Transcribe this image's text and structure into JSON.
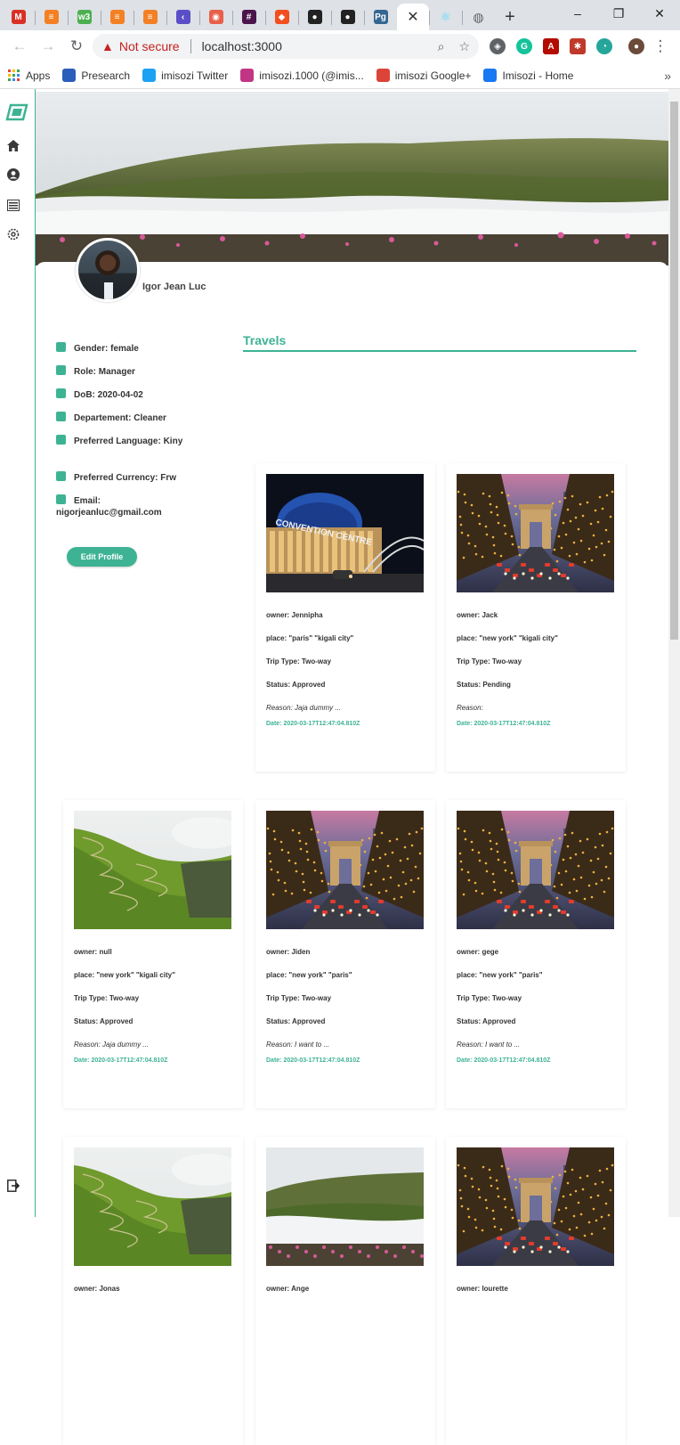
{
  "browser": {
    "tabs": [
      {
        "icon": "gmail-icon",
        "glyph": "M",
        "color": "#d93025"
      },
      {
        "icon": "stackoverflow-icon",
        "glyph": "≡",
        "color": "#f48024"
      },
      {
        "icon": "w3schools-icon",
        "glyph": "w3",
        "color": "#4caf50"
      },
      {
        "icon": "stackoverflow-icon",
        "glyph": "≡",
        "color": "#f48024"
      },
      {
        "icon": "stackoverflow-icon",
        "glyph": "≡",
        "color": "#f48024"
      },
      {
        "icon": "back-icon",
        "glyph": "‹",
        "color": "#5b4fc7"
      },
      {
        "icon": "babel-icon",
        "glyph": "◉",
        "color": "#e8604c"
      },
      {
        "icon": "slack-icon",
        "glyph": "#",
        "color": "#4a154b"
      },
      {
        "icon": "figma-icon",
        "glyph": "◆",
        "color": "#f24e1e"
      },
      {
        "icon": "github-icon",
        "glyph": "●",
        "color": "#222222"
      },
      {
        "icon": "github-icon",
        "glyph": "●",
        "color": "#222222"
      },
      {
        "icon": "postgres-icon",
        "glyph": "Pg",
        "color": "#336791"
      }
    ],
    "active_tab_icon": "close-icon",
    "active_tab_close": "✕",
    "globe_tab_icon": "globe-icon",
    "new_tab": "+",
    "window_controls": [
      "–",
      "❐",
      "✕"
    ],
    "security_label": "Not secure",
    "url": "localhost:3000",
    "bookmarks": [
      {
        "label": "Apps",
        "icon": "apps-icon",
        "color": "#ea4335"
      },
      {
        "label": "Presearch",
        "icon": "presearch-icon",
        "color": "#2b5dba"
      },
      {
        "label": "imisozi Twitter",
        "icon": "twitter-icon",
        "color": "#1da1f2"
      },
      {
        "label": "imisozi.1000 (@imis...",
        "icon": "instagram-icon",
        "color": "#c13584"
      },
      {
        "label": "imisozi Google+",
        "icon": "google-plus-icon",
        "color": "#db4437"
      },
      {
        "label": "Imisozi - Home",
        "icon": "facebook-icon",
        "color": "#1877f2"
      }
    ],
    "bookmarks_more": "»"
  },
  "profile": {
    "name": "Igor Jean Luc",
    "details": [
      {
        "icon": "gender-icon",
        "text": "Gender: female"
      },
      {
        "icon": "role-icon",
        "text": "Role: Manager"
      },
      {
        "icon": "calendar-icon",
        "text": "DoB: 2020-04-02"
      },
      {
        "icon": "department-icon",
        "text": "Departement: Cleaner"
      },
      {
        "icon": "language-icon",
        "text": "Preferred Language: Kiny"
      },
      {
        "icon": "currency-icon",
        "text": "Preferred Currency: Frw"
      },
      {
        "icon": "email-icon",
        "text": "Email: nigorjeanluc@gmail.com"
      }
    ],
    "edit_button": "Edit Profile"
  },
  "travels": {
    "title": "Travels",
    "cards": [
      {
        "photo": "convention",
        "owner": "owner: Jennipha",
        "place": "place: \"paris\" \"kigali city\"",
        "trip_type": "Trip Type: Two-way",
        "status": "Status: Approved",
        "reason": "Reason: Jaja dummy ...",
        "date": "Date: 2020-03-17T12:47:04.810Z"
      },
      {
        "photo": "arc",
        "owner": "owner: Jack",
        "place": "place: \"new york\" \"kigali city\"",
        "trip_type": "Trip Type: Two-way",
        "status": "Status: Pending",
        "reason": "Reason:",
        "date": "Date: 2020-03-17T12:47:04.810Z"
      },
      {
        "photo": "mountain-road",
        "owner": "owner: null",
        "place": "place: \"new york\" \"kigali city\"",
        "trip_type": "Trip Type: Two-way",
        "status": "Status: Approved",
        "reason": "Reason: Jaja dummy ...",
        "date": "Date: 2020-03-17T12:47:04.810Z"
      },
      {
        "photo": "arc",
        "owner": "owner: Jiden",
        "place": "place: \"new york\" \"paris\"",
        "trip_type": "Trip Type: Two-way",
        "status": "Status: Approved",
        "reason": "Reason: I want to ...",
        "date": "Date: 2020-03-17T12:47:04.810Z"
      },
      {
        "photo": "arc",
        "owner": "owner: gege",
        "place": "place: \"new york\" \"paris\"",
        "trip_type": "Trip Type: Two-way",
        "status": "Status: Approved",
        "reason": "Reason: I want to ...",
        "date": "Date: 2020-03-17T12:47:04.810Z"
      },
      {
        "photo": "mountain-road",
        "owner": "owner: Jonas"
      },
      {
        "photo": "valley-fog",
        "owner": "owner: Ange"
      },
      {
        "photo": "arc",
        "owner": "owner: lourette"
      }
    ]
  },
  "sidebar": {
    "items": [
      {
        "icon": "logo-icon"
      },
      {
        "icon": "home-icon"
      },
      {
        "icon": "profile-icon"
      },
      {
        "icon": "list-icon"
      },
      {
        "icon": "settings-icon"
      },
      {
        "icon": "logout-icon"
      }
    ]
  },
  "colors": {
    "accent": "#3db394"
  }
}
